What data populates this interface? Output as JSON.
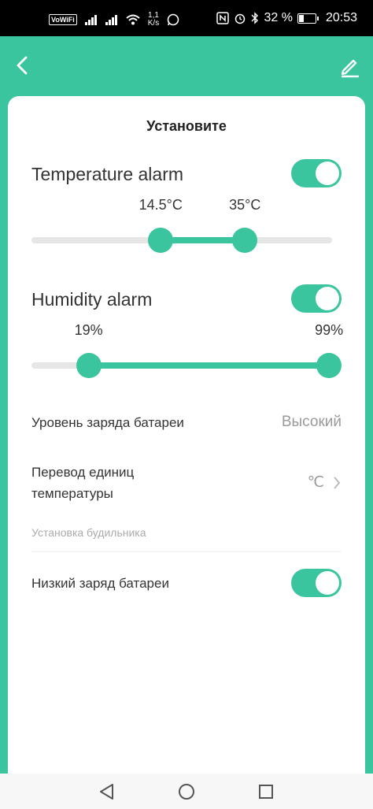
{
  "status_bar": {
    "volte": "VoWiFi",
    "speed_top": "1,1",
    "speed_bottom": "K/s",
    "battery_percent": "32 %",
    "battery_level": 0.32,
    "time": "20:53"
  },
  "header": {
    "back_icon": "chevron-left-icon",
    "edit_icon": "pencil-icon"
  },
  "card": {
    "title": "Установите",
    "temperature": {
      "label": "Temperature alarm",
      "enabled": true,
      "low_label": "14.5°C",
      "high_label": "35°C",
      "low_fraction": 0.43,
      "high_fraction": 0.71
    },
    "humidity": {
      "label": "Humidity alarm",
      "enabled": true,
      "low_label": "19%",
      "high_label": "99%",
      "low_fraction": 0.19,
      "high_fraction": 0.99
    },
    "battery_level": {
      "label": "Уровень заряда батареи",
      "value": "Высокий"
    },
    "temp_units": {
      "label_line1": "Перевод единиц",
      "label_line2": "температуры",
      "value": "℃"
    },
    "section_alarm": "Установка будильника",
    "low_battery": {
      "label": "Низкий заряд батареи",
      "enabled": true
    }
  },
  "nav": {
    "back_icon": "triangle-back-icon",
    "home_icon": "circle-home-icon",
    "recents_icon": "square-recents-icon"
  },
  "colors": {
    "accent": "#3AC59E",
    "track": "#E6E6E6"
  }
}
